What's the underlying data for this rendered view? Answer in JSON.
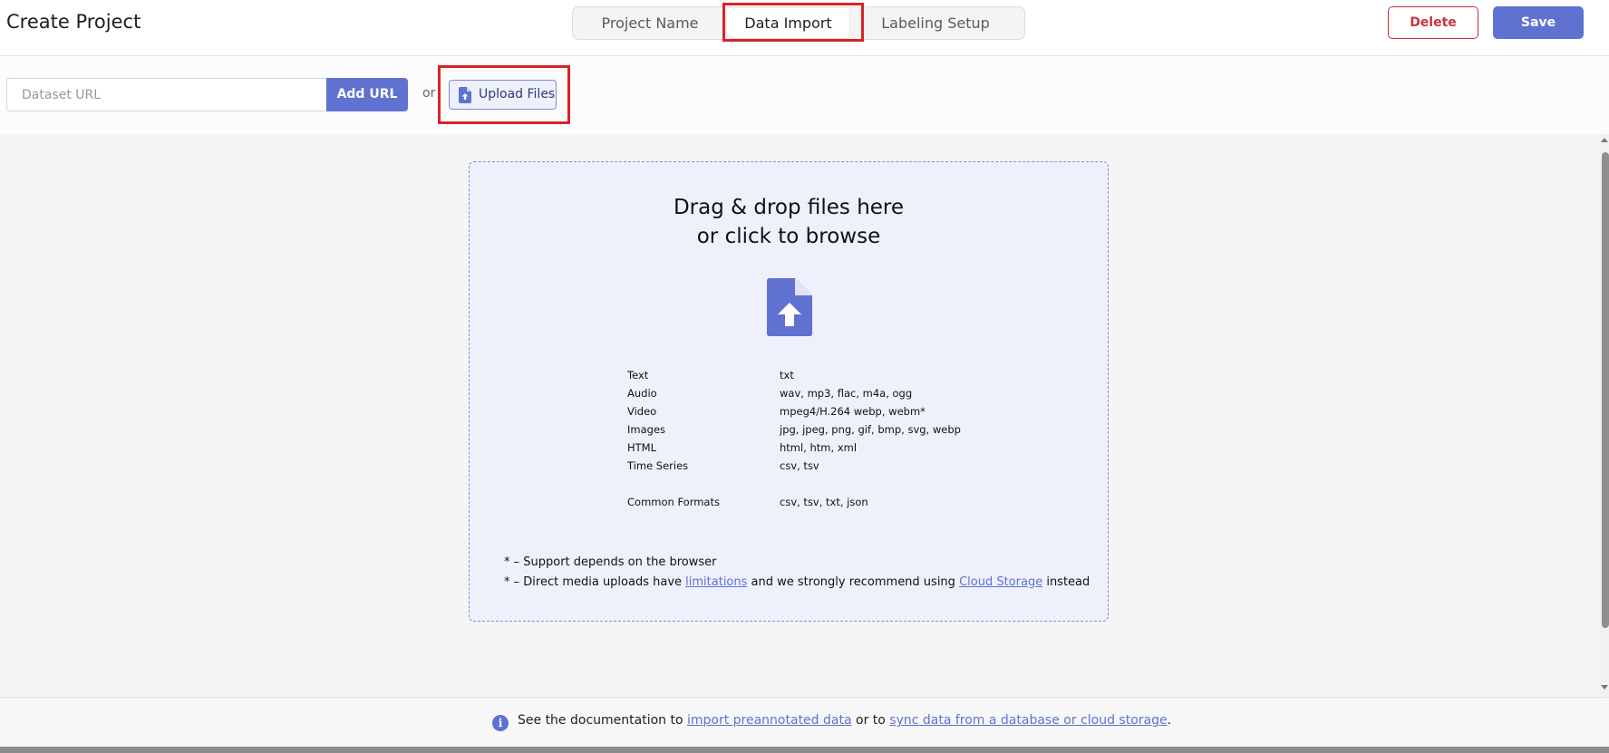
{
  "header": {
    "title": "Create Project",
    "tabs": [
      {
        "label": "Project Name",
        "active": false
      },
      {
        "label": "Data Import",
        "active": true
      },
      {
        "label": "Labeling Setup",
        "active": false
      }
    ],
    "delete_label": "Delete",
    "save_label": "Save"
  },
  "url_bar": {
    "placeholder": "Dataset URL",
    "value": "",
    "add_url_label": "Add URL",
    "or_text": "or",
    "upload_label": "Upload Files",
    "upload_icon": "file-upload-icon"
  },
  "dropzone": {
    "title_line1": "Drag & drop files here",
    "title_line2": "or click to browse",
    "icon": "file-upload-icon",
    "formats": [
      {
        "type": "Text",
        "ext": "txt"
      },
      {
        "type": "Audio",
        "ext": "wav, mp3, flac, m4a, ogg"
      },
      {
        "type": "Video",
        "ext": "mpeg4/H.264 webp, webm*"
      },
      {
        "type": "Images",
        "ext": "jpg, jpeg, png, gif, bmp, svg, webp"
      },
      {
        "type": "HTML",
        "ext": "html, htm, xml"
      },
      {
        "type": "Time Series",
        "ext": "csv, tsv"
      },
      {
        "type": "Common Formats",
        "ext": "csv, tsv, txt, json"
      }
    ],
    "note1": "* – Support depends on the browser",
    "note2_prefix": "* – Direct media uploads have ",
    "note2_link1": "limitations",
    "note2_middle": " and we strongly recommend using ",
    "note2_link2": "Cloud Storage",
    "note2_suffix": " instead"
  },
  "footer": {
    "icon": "info-icon",
    "prefix": "See the documentation to ",
    "link1": "import preannotated data",
    "middle": " or to ",
    "link2": "sync data from a database or cloud storage",
    "suffix": "."
  },
  "colors": {
    "accent": "#5f72d1",
    "delete": "#c8323a",
    "highlight": "#d9232a",
    "dropzone_bg": "#eef1fc"
  }
}
